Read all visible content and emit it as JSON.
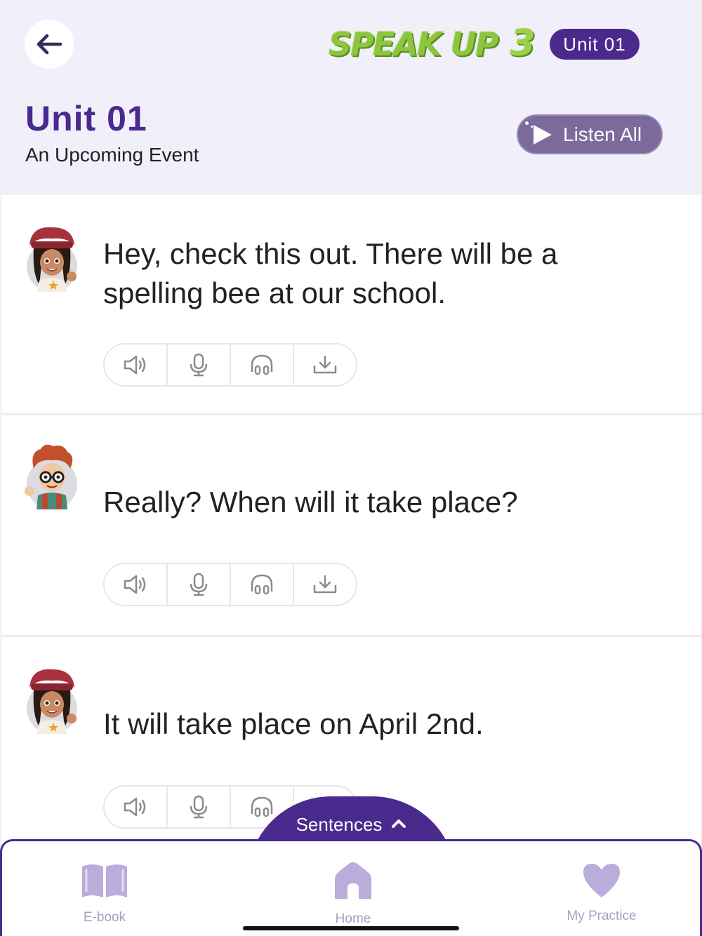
{
  "header": {
    "back_icon": "arrow-left-icon",
    "logo_text": "SPEAK UP",
    "logo_number": "3",
    "unit_pill": "Unit 01",
    "unit_title": "Unit 01",
    "unit_subtitle": "An Upcoming Event",
    "listen_all_label": "Listen All"
  },
  "sentences": [
    {
      "speaker": "girl-avatar",
      "text": "Hey, check this out. There will be a spelling bee at our school.",
      "controls": [
        "speaker-icon",
        "microphone-icon",
        "headphones-icon",
        "download-icon"
      ]
    },
    {
      "speaker": "boy-avatar",
      "text": "Really? When will it take place?",
      "controls": [
        "speaker-icon",
        "microphone-icon",
        "headphones-icon",
        "download-icon"
      ]
    },
    {
      "speaker": "girl-avatar",
      "text": "It will take place on April 2nd.",
      "controls": [
        "speaker-icon",
        "microphone-icon",
        "headphones-icon",
        "download-icon"
      ]
    }
  ],
  "sentences_tab": {
    "label": "Sentences",
    "icon": "chevron-up-icon"
  },
  "bottom_nav": {
    "items": [
      {
        "label": "E-book",
        "icon": "book-icon"
      },
      {
        "label": "Home",
        "icon": "home-icon"
      },
      {
        "label": "My Practice",
        "icon": "heart-icon"
      }
    ]
  },
  "colors": {
    "brand": "#4a2a8c",
    "header_bg": "#f1eff9",
    "listen_all_bg": "#7c6a9c",
    "logo_green": "#8cc63f",
    "nav_icon": "#b9addb"
  }
}
